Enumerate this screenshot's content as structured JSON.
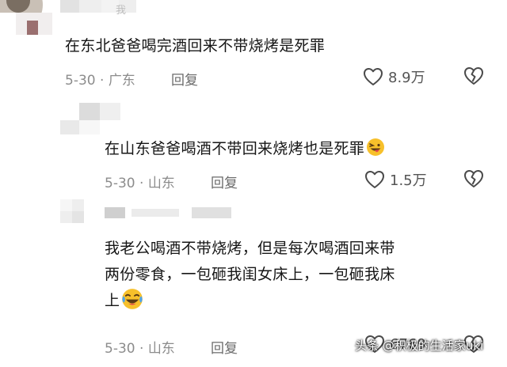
{
  "comments": [
    {
      "username": "我",
      "text": "在东北爸爸喝完酒回来不带烧烤是死罪",
      "date": "5-30",
      "location": "广东",
      "reply_label": "回复",
      "likes": "8.9万",
      "emoji": ""
    },
    {
      "username": "",
      "text": "在山东爸爸喝酒不带回来烧烤也是死罪",
      "date": "5-30",
      "location": "山东",
      "reply_label": "回复",
      "likes": "1.5万",
      "emoji": "grinning-tongue-emoji"
    },
    {
      "username": "",
      "text_lines": [
        "我老公喝酒不带烧烤，但是每次喝酒回来带",
        "两份零食，一包砸我闺女床上，一包砸我床",
        "上"
      ],
      "date": "5-30",
      "location": "山东",
      "reply_label": "回复",
      "likes": "6769",
      "emoji": "crying-laughing-emoji"
    }
  ],
  "watermark": "头条 @积极的生活家uki",
  "colors": {
    "text": "#161616",
    "meta": "#8c8c8c",
    "emoji_yellow": "#f7c02b"
  }
}
